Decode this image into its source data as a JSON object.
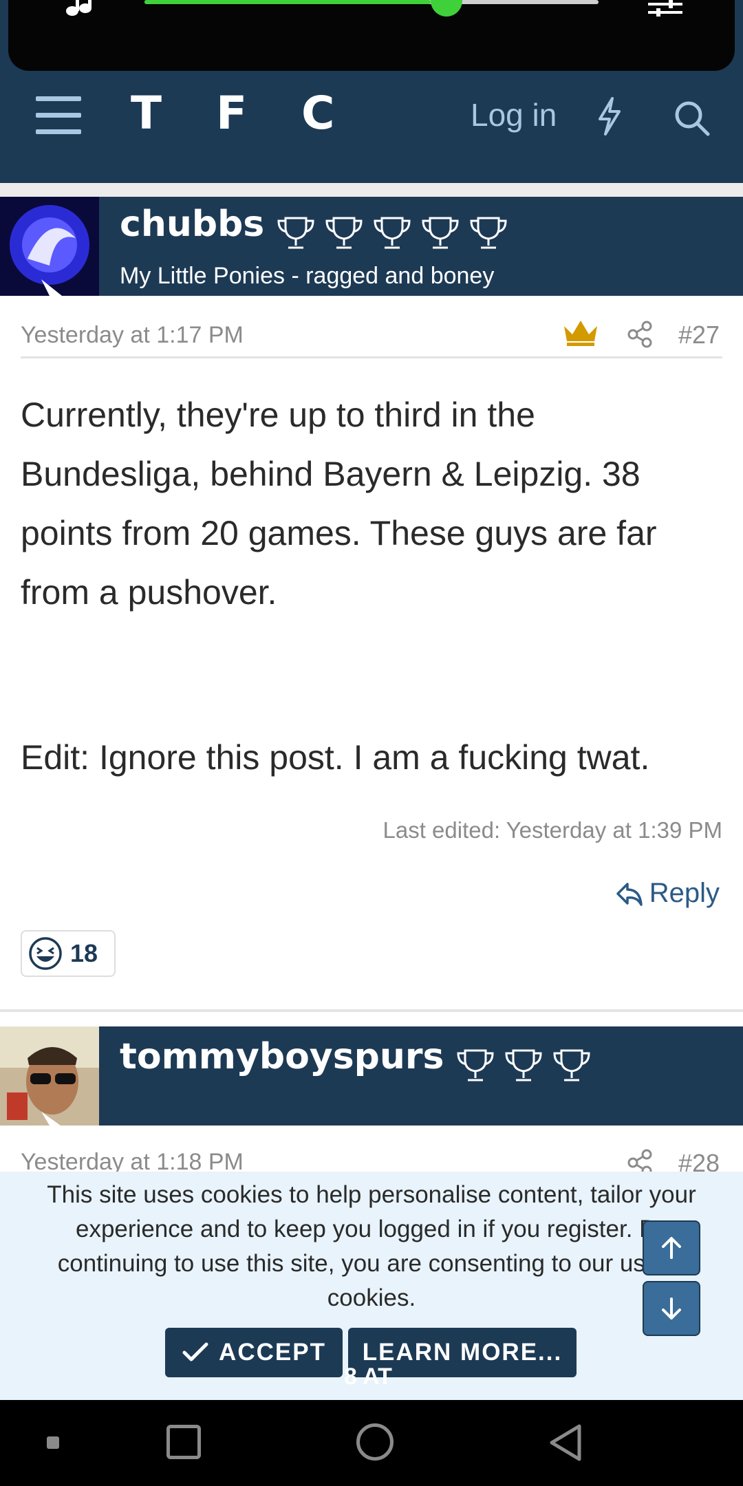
{
  "media": {
    "progress_percent": 63
  },
  "header": {
    "logo": "T F C",
    "login_label": "Log in"
  },
  "post1": {
    "username": "chubbs",
    "trophy_count": 5,
    "user_title": "My Little Ponies - ragged and boney",
    "date": "Yesterday at 1:17 PM",
    "post_number": "#27",
    "body": "Currently, they're up to third in the Bundesliga, behind Bayern & Leipzig. 38 points from 20 games. These guys are far from a pushover.",
    "edit_text": "Edit: Ignore this post. I am a fucking twat.",
    "last_edited": "Last edited: Yesterday at 1:39 PM",
    "reply_label": "Reply",
    "reaction_count": "18"
  },
  "post2": {
    "username": "tommyboyspurs",
    "trophy_count": 3,
    "date": "Yesterday at 1:18 PM",
    "post_number": "#28"
  },
  "cookie": {
    "text": "This site uses cookies to help personalise content, tailor your experience and to keep you logged in if you register. By continuing to use this site, you are consenting to our use of cookies.",
    "accept_label": "ACCEPT",
    "learn_more_label": "LEARN MORE...",
    "overlap_text": "8 AT"
  },
  "colors": {
    "header_bg": "#1d3a55",
    "accent_green": "#3ed13a",
    "crown": "#d39a00",
    "link": "#2b5a86"
  }
}
